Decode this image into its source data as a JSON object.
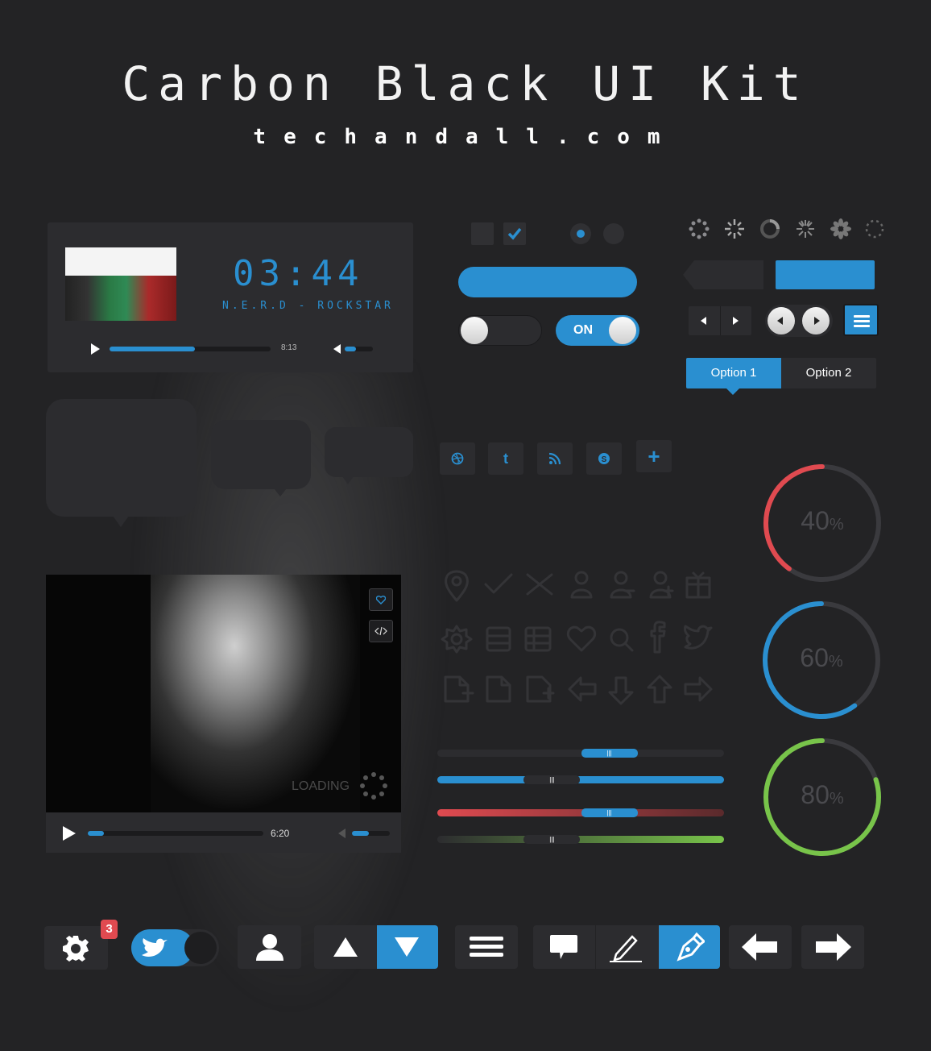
{
  "header": {
    "title": "Carbon Black UI Kit",
    "subtitle": "techandall.com"
  },
  "music_player": {
    "clock": "03:44",
    "track": "N.E.R.D - ROCKSTAR",
    "duration": "8:13",
    "progress": 0.53,
    "volume": 0.4
  },
  "controls": {
    "checkbox_unchecked": false,
    "checkbox_checked": true,
    "radio_selected_index": 0,
    "toggle_off": false,
    "toggle_on_label": "ON",
    "toggle_on": true
  },
  "segmented": {
    "options": [
      "Option 1",
      "Option 2"
    ],
    "selected": 0
  },
  "social": {
    "icons": [
      "dribbble-icon",
      "twitter-icon",
      "rss-icon",
      "skype-icon",
      "plus-icon"
    ],
    "plus": "+",
    "twitter": "t"
  },
  "rings": [
    {
      "value": "40",
      "unit": "%",
      "color": "#e04a50",
      "fraction": 0.4
    },
    {
      "value": "60",
      "unit": "%",
      "color": "#2a8fd0",
      "fraction": 0.6
    },
    {
      "value": "80",
      "unit": "%",
      "color": "#78c44a",
      "fraction": 0.8
    }
  ],
  "video_player": {
    "loading": "LOADING",
    "duration": "6:20",
    "progress": 0.09,
    "volume": 0.45
  },
  "sliders": [
    {
      "color": "#2a8fd0",
      "value": 0.6
    },
    {
      "color": "#2a8fd0",
      "value": 0.4
    },
    {
      "color": "#e04a50",
      "value": 0.6
    },
    {
      "color": "#78c44a",
      "value": 0.4
    }
  ],
  "bottom_bar": {
    "notification_count": "3"
  },
  "colors": {
    "accent": "#2a8fd0",
    "red": "#e04a50",
    "green": "#78c44a",
    "panel": "#2c2c2f",
    "background": "#232325"
  }
}
